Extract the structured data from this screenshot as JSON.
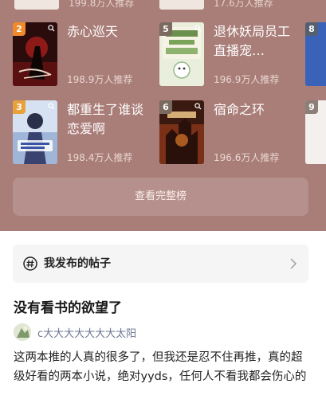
{
  "ranking": {
    "previous_row": {
      "left_count": "199.8万人推荐",
      "right_count": "17.6万人推荐"
    },
    "books": [
      {
        "rank": "2",
        "title": "赤心巡天",
        "recommend": "198.9万人推荐",
        "badge_color": "#f08a2b",
        "cover_theme": "dark-red"
      },
      {
        "rank": "5",
        "title": "退休妖局员工直播宠…",
        "recommend": "196.9万人推荐",
        "badge_color": "#7a6a60",
        "cover_theme": "light-green"
      },
      {
        "rank": "3",
        "title": "都重生了谁谈恋爱啊",
        "recommend": "198.4万人推荐",
        "badge_color": "#e9a23b",
        "cover_theme": "blue-anime"
      },
      {
        "rank": "6",
        "title": "宿命之环",
        "recommend": "196.6万人推荐",
        "badge_color": "#7a6a60",
        "cover_theme": "fire-castle"
      }
    ],
    "edge_books": [
      {
        "rank": "8",
        "cover_theme": "blue"
      },
      {
        "rank": "9",
        "cover_theme": "white"
      }
    ],
    "full_list_button": "查看完整榜"
  },
  "posts_entry": {
    "label": "我发布的帖子",
    "icon": "hash-icon"
  },
  "post": {
    "title": "没有看书的欲望了",
    "author": "c大大大大大大大太阳",
    "body": "这两本推的人真的很多了，但我还是忍不住再推，真的超级好看的两本小说，绝对yyds，任何人不看我都会伤心的"
  }
}
